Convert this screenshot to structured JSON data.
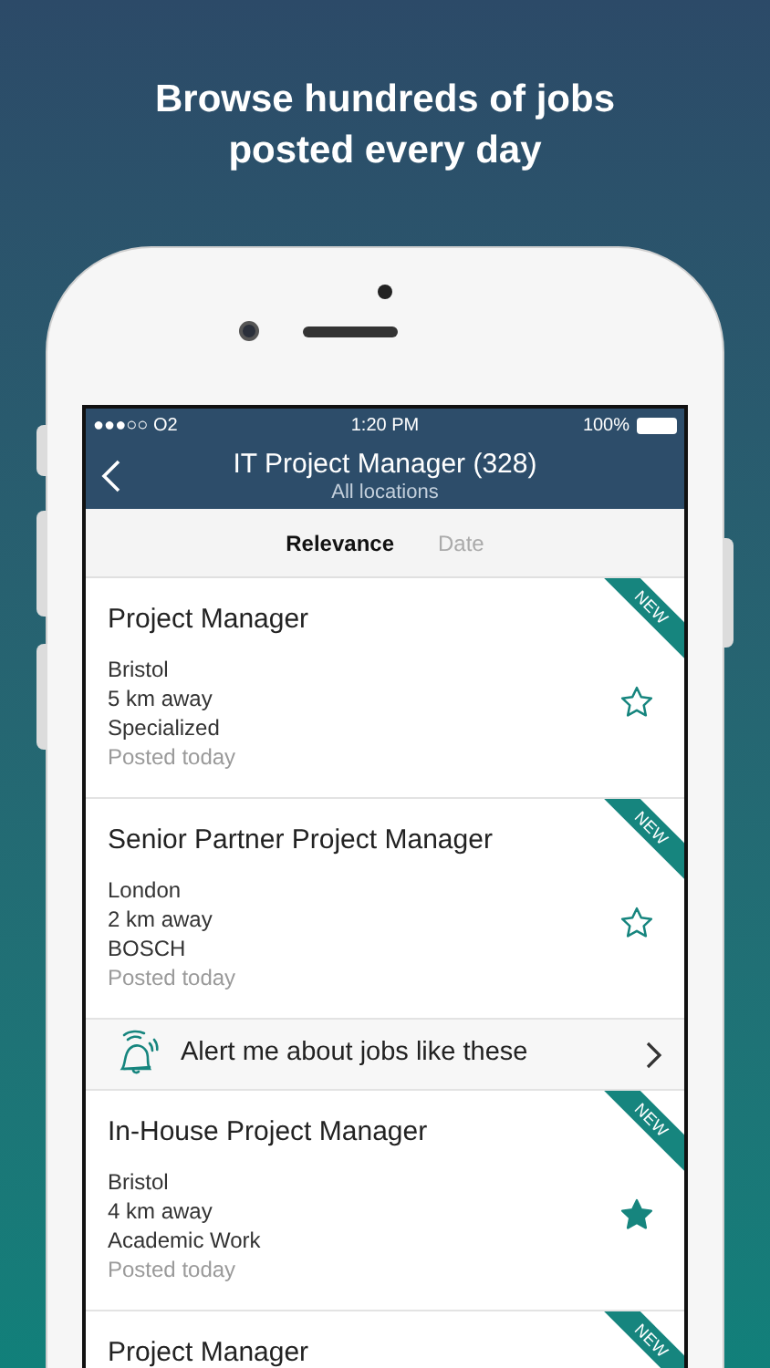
{
  "headline": "Browse hundreds of jobs posted every day",
  "status_bar": {
    "carrier": "●●●○○ O2",
    "time": "1:20 PM",
    "battery": "100%"
  },
  "nav": {
    "title": "IT Project Manager (328)",
    "subtitle": "All locations"
  },
  "sort_tabs": [
    {
      "label": "Relevance",
      "selected": true
    },
    {
      "label": "Date",
      "selected": false
    }
  ],
  "results": [
    {
      "kind": "job",
      "title": "Project Manager",
      "lines": [
        "Bristol",
        "5 km away",
        "Specialized"
      ],
      "posted": "Posted today",
      "badge": "NEW",
      "saved": false
    },
    {
      "kind": "job",
      "title": "Senior Partner Project Manager",
      "lines": [
        "London",
        "2 km away",
        "BOSCH"
      ],
      "posted": "Posted today",
      "badge": "NEW",
      "saved": false
    },
    {
      "kind": "alert",
      "title": "Alert me about jobs like these"
    },
    {
      "kind": "job",
      "title": "In-House Project Manager",
      "lines": [
        "Bristol",
        "4 km away",
        "Academic Work"
      ],
      "posted": "Posted today",
      "badge": "NEW",
      "saved": true
    },
    {
      "kind": "job",
      "title": "Project Manager",
      "badge": "NEW"
    }
  ]
}
